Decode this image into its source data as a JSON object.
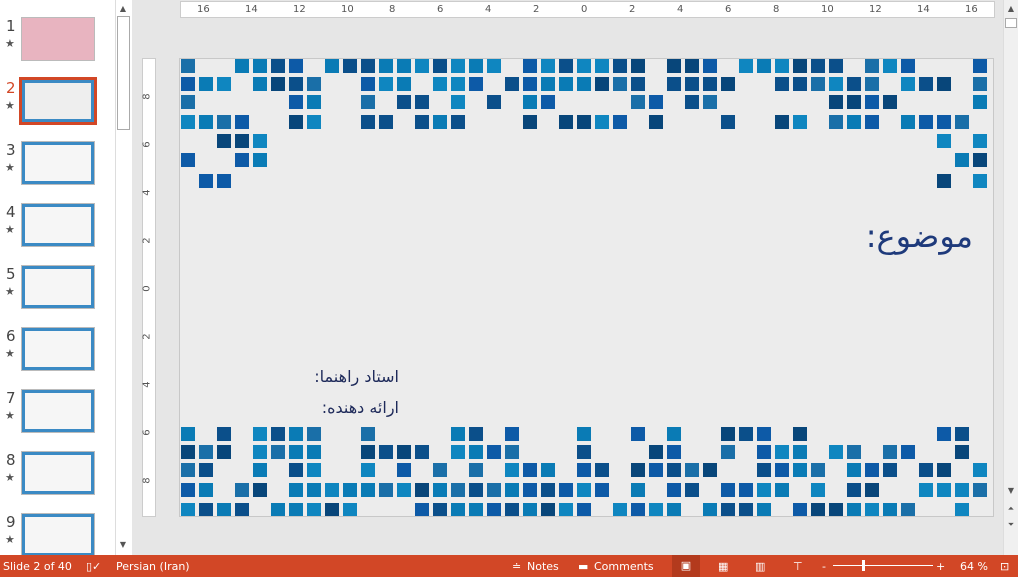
{
  "thumbnails": [
    {
      "num": "1",
      "bg": "#e8b4c0"
    },
    {
      "num": "2",
      "bg": "#eeeeee",
      "selected": true
    },
    {
      "num": "3",
      "bg": "#f6f6f6"
    },
    {
      "num": "4",
      "bg": "#f6f6f6"
    },
    {
      "num": "5",
      "bg": "#f6f6f6"
    },
    {
      "num": "6",
      "bg": "#f6f6f6"
    },
    {
      "num": "7",
      "bg": "#f6f6f6"
    },
    {
      "num": "8",
      "bg": "#f6f6f6"
    },
    {
      "num": "9",
      "bg": "#f6f6f6"
    }
  ],
  "ruler": {
    "h": [
      "16",
      "14",
      "12",
      "10",
      "8",
      "6",
      "4",
      "2",
      "0",
      "2",
      "4",
      "6",
      "8",
      "10",
      "12",
      "14",
      "16"
    ],
    "v": [
      "8",
      "6",
      "4",
      "2",
      "0",
      "2",
      "4",
      "6",
      "8"
    ]
  },
  "slide": {
    "title": "موضوع:",
    "supervisor": "استاد راهنما:",
    "presenter": "ارائه دهنده:",
    "square_colors": [
      "#0b4f8a",
      "#0d5aa7",
      "#0a7bb5",
      "#1a6fa8",
      "#08467a",
      "#0f86c0"
    ]
  },
  "status": {
    "slide": "Slide 2 of 40",
    "language": "Persian (Iran)",
    "notes": "Notes",
    "comments": "Comments",
    "zoom": "64 %"
  }
}
